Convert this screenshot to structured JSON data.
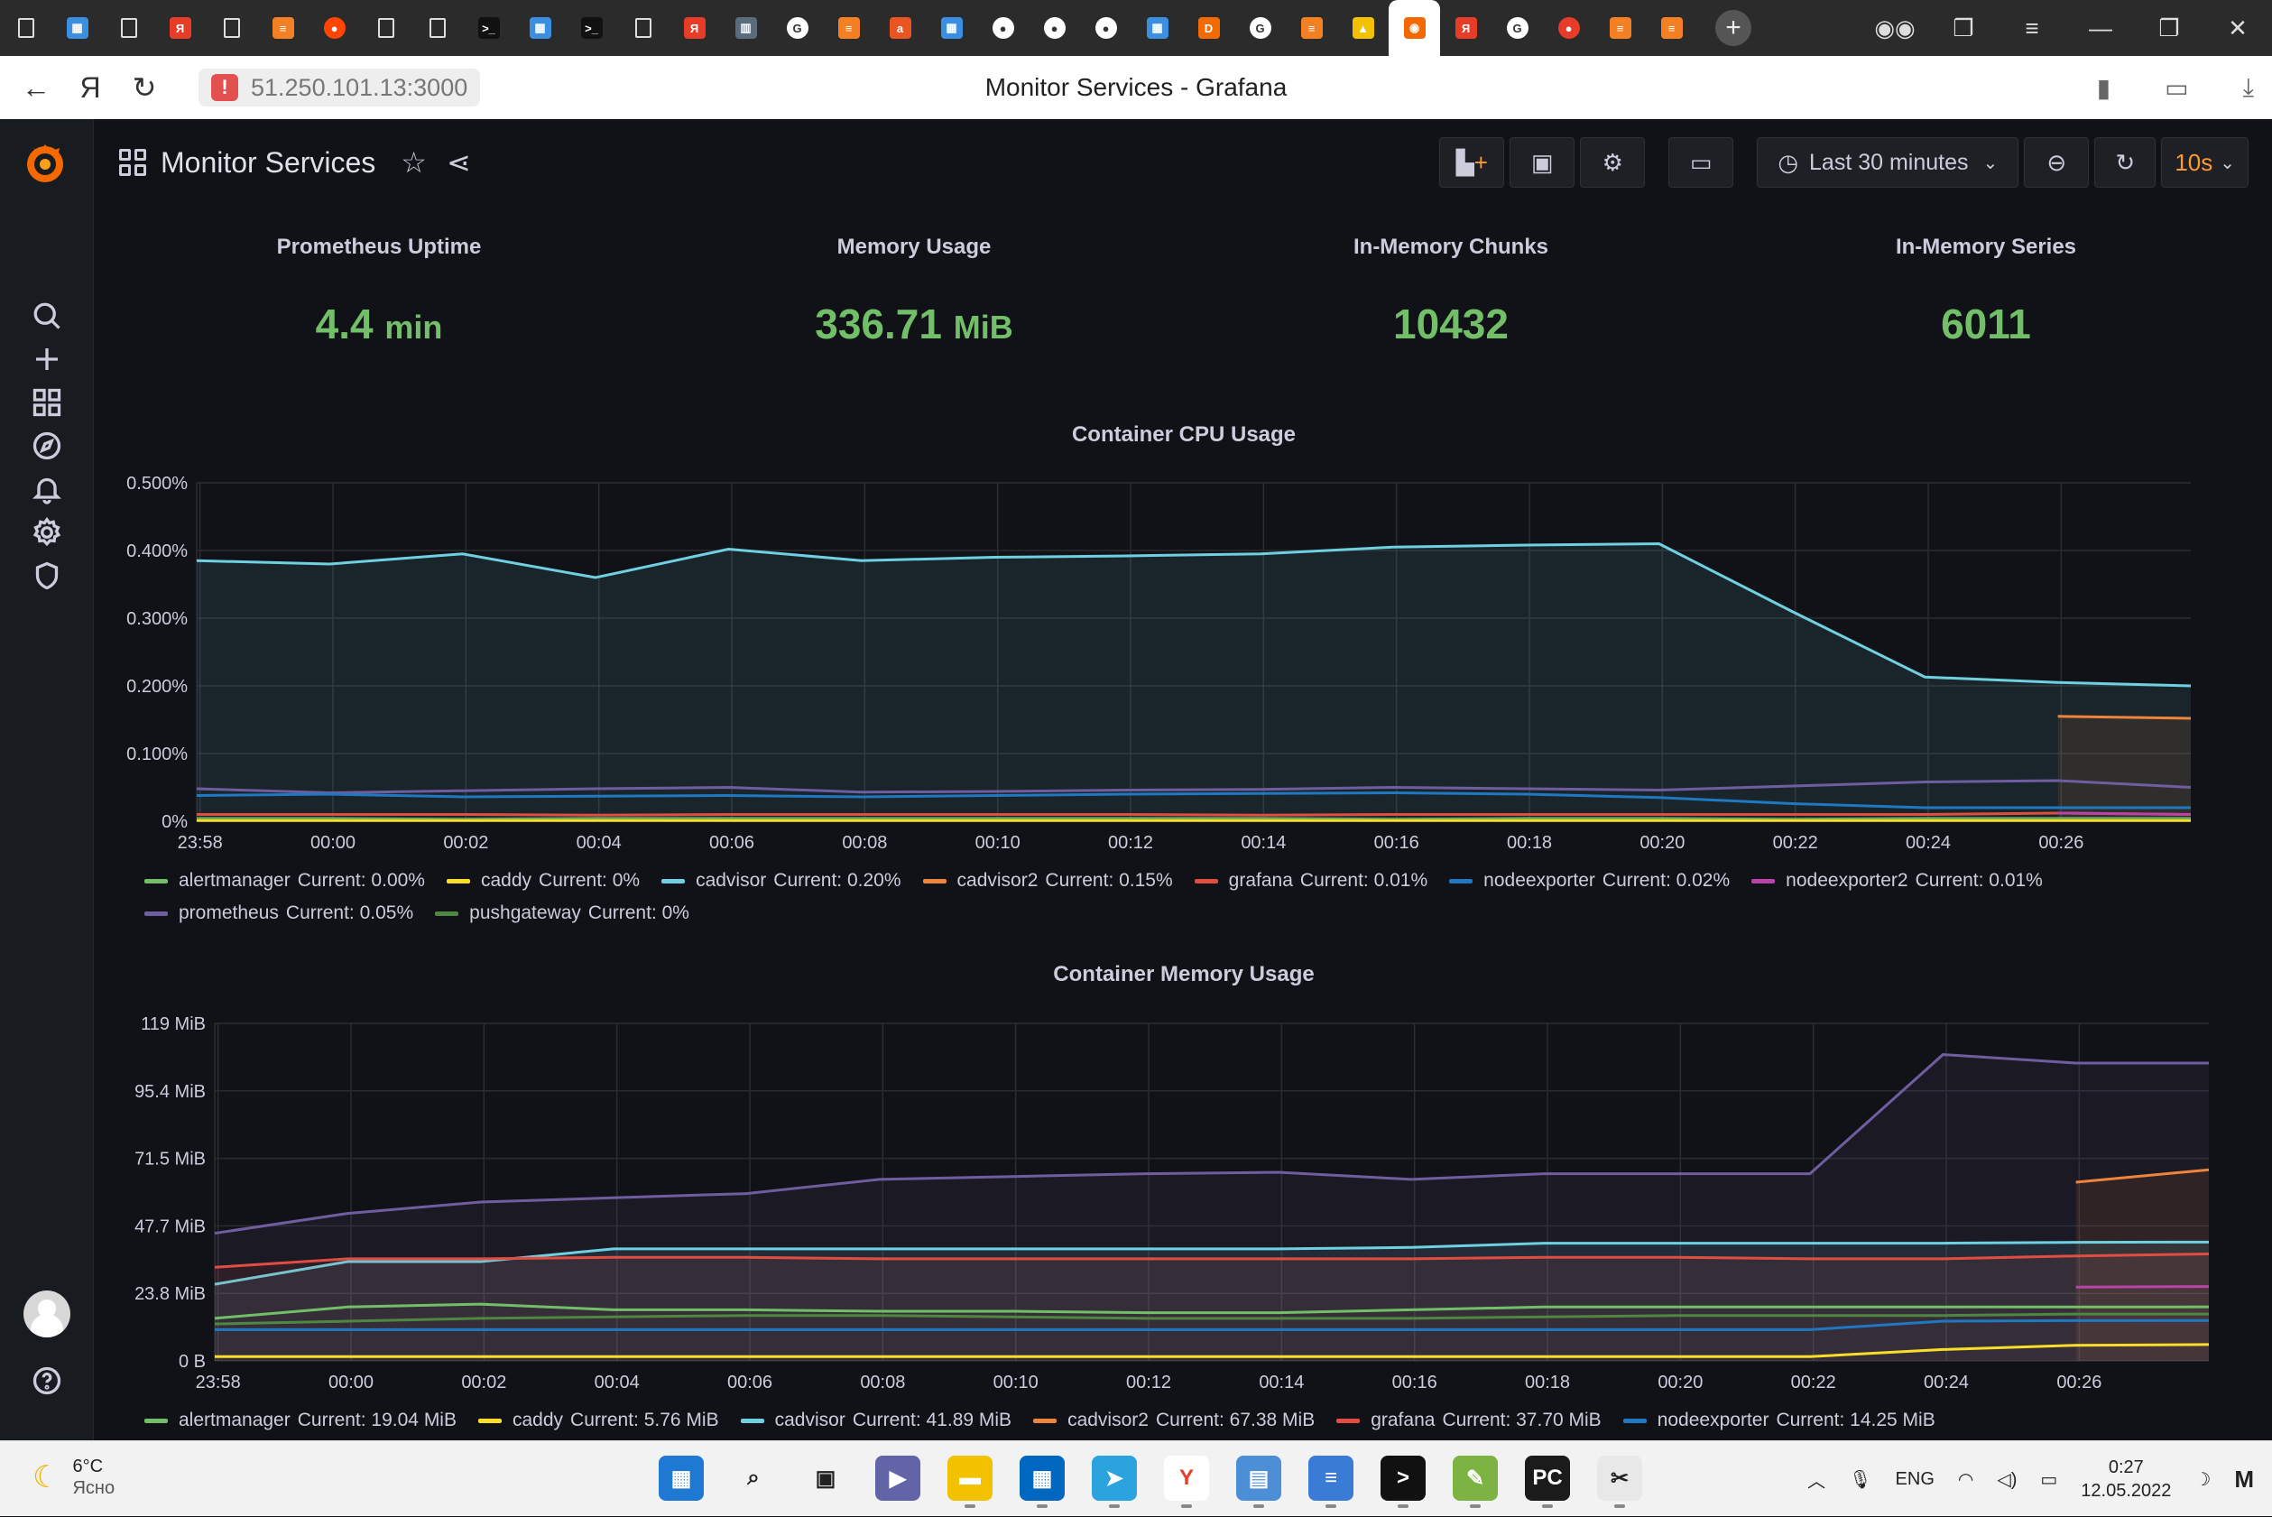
{
  "browser": {
    "url": "51.250.101.13:3000",
    "page_title": "Monitor Services - Grafana",
    "tabs": [
      {
        "icon": "document-icon",
        "color": "#2b2b2b",
        "glyph": ""
      },
      {
        "icon": "windows-icon",
        "color": "#3b8ee0",
        "glyph": "▦"
      },
      {
        "icon": "document-icon",
        "color": "#2b2b2b",
        "glyph": ""
      },
      {
        "icon": "yandex-icon",
        "color": "#e63c28",
        "glyph": "Я"
      },
      {
        "icon": "document-icon",
        "color": "#2b2b2b",
        "glyph": ""
      },
      {
        "icon": "stackoverflow-icon",
        "color": "#f48024",
        "glyph": "≡"
      },
      {
        "icon": "reddit-icon",
        "color": "#ff4500",
        "glyph": "●"
      },
      {
        "icon": "document-icon",
        "color": "#2b2b2b",
        "glyph": ""
      },
      {
        "icon": "document-icon",
        "color": "#2b2b2b",
        "glyph": ""
      },
      {
        "icon": "terminal-icon",
        "color": "#111",
        "glyph": ">_"
      },
      {
        "icon": "windows-icon",
        "color": "#3b8ee0",
        "glyph": "▦"
      },
      {
        "icon": "terminal-icon",
        "color": "#111",
        "glyph": ">_"
      },
      {
        "icon": "document-icon",
        "color": "#2b2b2b",
        "glyph": ""
      },
      {
        "icon": "yandex-icon",
        "color": "#e63c28",
        "glyph": "Я"
      },
      {
        "icon": "book-icon",
        "color": "#5a6b7c",
        "glyph": "▥"
      },
      {
        "icon": "google-icon",
        "color": "#ffffff",
        "glyph": "G"
      },
      {
        "icon": "stackoverflow-icon",
        "color": "#f48024",
        "glyph": "≡"
      },
      {
        "icon": "askubuntu-icon",
        "color": "#e95420",
        "glyph": "a"
      },
      {
        "icon": "windows-icon",
        "color": "#3b8ee0",
        "glyph": "▦"
      },
      {
        "icon": "github-icon",
        "color": "#ffffff",
        "glyph": "●"
      },
      {
        "icon": "github-icon",
        "color": "#ffffff",
        "glyph": "●"
      },
      {
        "icon": "github-icon",
        "color": "#ffffff",
        "glyph": "●"
      },
      {
        "icon": "windows-icon",
        "color": "#3b8ee0",
        "glyph": "▦"
      },
      {
        "icon": "dns-icon",
        "color": "#f26b00",
        "glyph": "D"
      },
      {
        "icon": "google-icon",
        "color": "#ffffff",
        "glyph": "G"
      },
      {
        "icon": "stackoverflow-icon",
        "color": "#f48024",
        "glyph": "≡"
      },
      {
        "icon": "image-icon",
        "color": "#f2c200",
        "glyph": "▲"
      },
      {
        "icon": "grafana-icon",
        "color": "#f46800",
        "glyph": "◉"
      },
      {
        "icon": "yandex-icon",
        "color": "#e63c28",
        "glyph": "Я"
      },
      {
        "icon": "google-icon",
        "color": "#ffffff",
        "glyph": "G"
      },
      {
        "icon": "podcast-icon",
        "color": "#e63c28",
        "glyph": "●"
      },
      {
        "icon": "stackoverflow-icon",
        "color": "#f48024",
        "glyph": "≡"
      },
      {
        "icon": "stackoverflow-icon",
        "color": "#f48024",
        "glyph": "≡"
      }
    ],
    "active_tab_index": 27
  },
  "dashboard": {
    "title": "Monitor Services",
    "time_range": "Last 30 minutes",
    "refresh": "10s"
  },
  "stats": [
    {
      "title": "Prometheus Uptime",
      "value": "4.4",
      "unit": "min"
    },
    {
      "title": "Memory Usage",
      "value": "336.71",
      "unit": "MiB"
    },
    {
      "title": "In-Memory Chunks",
      "value": "10432",
      "unit": ""
    },
    {
      "title": "In-Memory Series",
      "value": "6011",
      "unit": ""
    }
  ],
  "cpu_panel": {
    "title": "Container CPU Usage",
    "legend": [
      {
        "name": "alertmanager",
        "current": "Current: 0.00%",
        "color": "#73bf69"
      },
      {
        "name": "caddy",
        "current": "Current: 0%",
        "color": "#fade2a"
      },
      {
        "name": "cadvisor",
        "current": "Current: 0.20%",
        "color": "#6ed0e0"
      },
      {
        "name": "cadvisor2",
        "current": "Current: 0.15%",
        "color": "#ef843c"
      },
      {
        "name": "grafana",
        "current": "Current: 0.01%",
        "color": "#e24d42"
      },
      {
        "name": "nodeexporter",
        "current": "Current: 0.02%",
        "color": "#1f78c1"
      },
      {
        "name": "nodeexporter2",
        "current": "Current: 0.01%",
        "color": "#ba43a9"
      },
      {
        "name": "prometheus",
        "current": "Current: 0.05%",
        "color": "#705da0"
      },
      {
        "name": "pushgateway",
        "current": "Current: 0%",
        "color": "#508642"
      }
    ]
  },
  "mem_panel": {
    "title": "Container Memory Usage",
    "legend": [
      {
        "name": "alertmanager",
        "current": "Current: 19.04 MiB",
        "color": "#73bf69"
      },
      {
        "name": "caddy",
        "current": "Current: 5.76 MiB",
        "color": "#fade2a"
      },
      {
        "name": "cadvisor",
        "current": "Current: 41.89 MiB",
        "color": "#6ed0e0"
      },
      {
        "name": "cadvisor2",
        "current": "Current: 67.38 MiB",
        "color": "#ef843c"
      },
      {
        "name": "grafana",
        "current": "Current: 37.70 MiB",
        "color": "#e24d42"
      },
      {
        "name": "nodeexporter",
        "current": "Current: 14.25 MiB",
        "color": "#1f78c1"
      }
    ]
  },
  "chart_data": [
    {
      "type": "line",
      "title": "Container CPU Usage",
      "x": [
        "23:57",
        "23:59",
        "00:01",
        "00:03",
        "00:05",
        "00:07",
        "00:09",
        "00:11",
        "00:13",
        "00:15",
        "00:17",
        "00:19",
        "00:21",
        "00:23",
        "00:25",
        "00:27"
      ],
      "x_ticks": [
        "23:58",
        "00:00",
        "00:02",
        "00:04",
        "00:06",
        "00:08",
        "00:10",
        "00:12",
        "00:14",
        "00:16",
        "00:18",
        "00:20",
        "00:22",
        "00:24",
        "00:26"
      ],
      "y_ticks": [
        "0%",
        "0.100%",
        "0.200%",
        "0.300%",
        "0.400%",
        "0.500%"
      ],
      "ylim": [
        0,
        0.5
      ],
      "unit": "%",
      "series": [
        {
          "name": "cadvisor",
          "color": "#6ed0e0",
          "fill": true,
          "values": [
            0.385,
            0.38,
            0.395,
            0.36,
            0.402,
            0.385,
            0.39,
            0.392,
            0.395,
            0.405,
            0.408,
            0.41,
            0.31,
            0.213,
            0.205,
            0.2
          ]
        },
        {
          "name": "cadvisor2",
          "color": "#ef843c",
          "fill": true,
          "values": [
            null,
            null,
            null,
            null,
            null,
            null,
            null,
            null,
            null,
            null,
            null,
            null,
            null,
            null,
            0.155,
            0.152
          ]
        },
        {
          "name": "prometheus",
          "color": "#705da0",
          "fill": false,
          "values": [
            0.048,
            0.042,
            0.045,
            0.048,
            0.05,
            0.043,
            0.044,
            0.046,
            0.047,
            0.05,
            0.048,
            0.046,
            0.052,
            0.058,
            0.06,
            0.05
          ]
        },
        {
          "name": "nodeexporter",
          "color": "#1f78c1",
          "fill": false,
          "values": [
            0.038,
            0.04,
            0.036,
            0.037,
            0.038,
            0.036,
            0.038,
            0.04,
            0.041,
            0.042,
            0.04,
            0.035,
            0.026,
            0.02,
            0.02,
            0.02
          ]
        },
        {
          "name": "grafana",
          "color": "#e24d42",
          "fill": false,
          "values": [
            0.01,
            0.01,
            0.01,
            0.009,
            0.01,
            0.01,
            0.01,
            0.01,
            0.009,
            0.01,
            0.01,
            0.01,
            0.01,
            0.01,
            0.012,
            0.01
          ]
        },
        {
          "name": "nodeexporter2",
          "color": "#ba43a9",
          "fill": false,
          "values": [
            null,
            null,
            null,
            null,
            null,
            null,
            null,
            null,
            null,
            null,
            null,
            null,
            null,
            null,
            0.012,
            0.01
          ]
        },
        {
          "name": "alertmanager",
          "color": "#73bf69",
          "fill": false,
          "values": [
            0.004,
            0.004,
            0.003,
            0.004,
            0.004,
            0.004,
            0.004,
            0.004,
            0.004,
            0.003,
            0.004,
            0.004,
            0.003,
            0.004,
            0.004,
            0.004
          ]
        },
        {
          "name": "pushgateway",
          "color": "#508642",
          "fill": false,
          "values": [
            0.002,
            0.002,
            0.002,
            0.002,
            0.002,
            0.002,
            0.002,
            0.002,
            0.002,
            0.002,
            0.002,
            0.002,
            0.002,
            0.002,
            0.002,
            0.002
          ]
        },
        {
          "name": "caddy",
          "color": "#fade2a",
          "fill": false,
          "values": [
            0.001,
            0.001,
            0.001,
            0.001,
            0.001,
            0.001,
            0.001,
            0.001,
            0.001,
            0.001,
            0.001,
            0.001,
            0.001,
            0.001,
            0.001,
            0.001
          ]
        }
      ]
    },
    {
      "type": "line",
      "title": "Container Memory Usage",
      "x": [
        "23:57",
        "23:59",
        "00:01",
        "00:03",
        "00:05",
        "00:07",
        "00:09",
        "00:11",
        "00:13",
        "00:15",
        "00:17",
        "00:19",
        "00:21",
        "00:23",
        "00:25",
        "00:27"
      ],
      "x_ticks": [
        "23:58",
        "00:00",
        "00:02",
        "00:04",
        "00:06",
        "00:08",
        "00:10",
        "00:12",
        "00:14",
        "00:16",
        "00:18",
        "00:20",
        "00:22",
        "00:24",
        "00:26"
      ],
      "y_ticks": [
        "0 B",
        "23.8 MiB",
        "47.7 MiB",
        "71.5 MiB",
        "95.4 MiB",
        "119 MiB"
      ],
      "ylim": [
        0,
        119
      ],
      "unit": "MiB",
      "series": [
        {
          "name": "prometheus",
          "color": "#705da0",
          "fill": true,
          "values": [
            45,
            52,
            56,
            57.5,
            59,
            64,
            65,
            66,
            66.5,
            64,
            66,
            66,
            66,
            108,
            105,
            105
          ]
        },
        {
          "name": "cadvisor2",
          "color": "#ef843c",
          "fill": true,
          "values": [
            null,
            null,
            null,
            null,
            null,
            null,
            null,
            null,
            null,
            null,
            null,
            null,
            null,
            null,
            63,
            67.38
          ]
        },
        {
          "name": "cadvisor",
          "color": "#6ed0e0",
          "fill": true,
          "values": [
            27,
            35,
            35,
            39.5,
            39.5,
            39.5,
            39.5,
            39.5,
            39.5,
            40,
            41.5,
            41.5,
            41.5,
            41.5,
            41.8,
            41.89
          ]
        },
        {
          "name": "grafana",
          "color": "#e24d42",
          "fill": true,
          "values": [
            33,
            36,
            36,
            36.5,
            36.5,
            36,
            36,
            36,
            36,
            36,
            36.5,
            36.5,
            36,
            36,
            37,
            37.7
          ]
        },
        {
          "name": "nodeexporter2",
          "color": "#ba43a9",
          "fill": false,
          "values": [
            null,
            null,
            null,
            null,
            null,
            null,
            null,
            null,
            null,
            null,
            null,
            null,
            null,
            null,
            26,
            26.2
          ]
        },
        {
          "name": "alertmanager",
          "color": "#73bf69",
          "fill": false,
          "values": [
            15,
            19,
            20,
            18,
            18,
            17.5,
            17.5,
            17,
            17,
            18,
            19,
            19,
            19,
            19,
            19,
            19.04
          ]
        },
        {
          "name": "pushgateway",
          "color": "#508642",
          "fill": false,
          "values": [
            13,
            14,
            15,
            15.5,
            16,
            16,
            15.5,
            15,
            15,
            15,
            15.5,
            16,
            16,
            16,
            16.5,
            16.5
          ]
        },
        {
          "name": "nodeexporter",
          "color": "#1f78c1",
          "fill": false,
          "values": [
            11,
            11,
            11,
            11,
            11,
            11,
            11,
            11,
            11,
            11,
            11,
            11,
            11,
            14,
            14.2,
            14.25
          ]
        },
        {
          "name": "caddy",
          "color": "#fade2a",
          "fill": false,
          "values": [
            1.5,
            1.5,
            1.5,
            1.5,
            1.5,
            1.5,
            1.5,
            1.5,
            1.5,
            1.5,
            1.5,
            1.5,
            1.5,
            4,
            5.5,
            5.76
          ]
        }
      ]
    }
  ],
  "taskbar": {
    "temperature": "6°C",
    "weather": "Ясно",
    "language": "ENG",
    "time": "0:27",
    "date": "12.05.2022",
    "apps": [
      {
        "icon": "start-icon",
        "color": "#1f78d1",
        "glyph": "▦"
      },
      {
        "icon": "search-icon",
        "color": "#f2f2f2",
        "glyph": "⌕"
      },
      {
        "icon": "task-view-icon",
        "color": "#f2f2f2",
        "glyph": "▣"
      },
      {
        "icon": "teams-icon",
        "color": "#6264a7",
        "glyph": "▶"
      },
      {
        "icon": "file-explorer-icon",
        "color": "#f2c200",
        "glyph": "▬"
      },
      {
        "icon": "store-icon",
        "color": "#0067c0",
        "glyph": "▦"
      },
      {
        "icon": "telegram-icon",
        "color": "#2aa3df",
        "glyph": "➤"
      },
      {
        "icon": "yandex-browser-icon",
        "color": "#ffffff",
        "glyph": "Y"
      },
      {
        "icon": "control-panel-icon",
        "color": "#4d8fd6",
        "glyph": "▤"
      },
      {
        "icon": "notepad-icon",
        "color": "#3a7bd5",
        "glyph": "≡"
      },
      {
        "icon": "terminal-icon",
        "color": "#111111",
        "glyph": ">"
      },
      {
        "icon": "paint-icon",
        "color": "#7cb342",
        "glyph": "✎"
      },
      {
        "icon": "pycharm-icon",
        "color": "#1b1b1b",
        "glyph": "PC"
      },
      {
        "icon": "snipping-tool-icon",
        "color": "#e8e8e8",
        "glyph": "✂"
      }
    ]
  }
}
